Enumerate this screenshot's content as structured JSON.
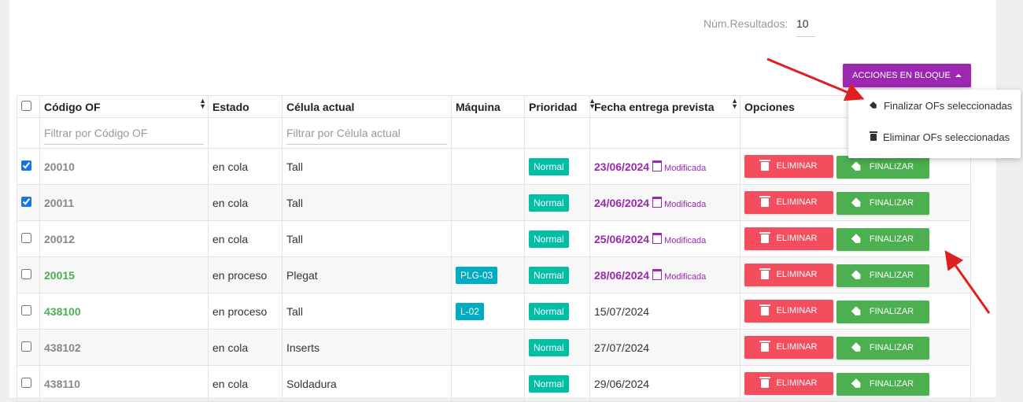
{
  "results": {
    "label": "Núm.Resultados:",
    "value": "10"
  },
  "bulk": {
    "label": "ACCIONES EN BLOQUE",
    "items": [
      {
        "icon": "tag-icon",
        "label": "Finalizar OFs seleccionadas"
      },
      {
        "icon": "trash-icon",
        "label": "Eliminar OFs seleccionadas"
      }
    ]
  },
  "columns": [
    "Código OF",
    "Estado",
    "Célula actual",
    "Máquina",
    "Prioridad",
    "Fecha entrega prevista",
    "Opciones"
  ],
  "filters": {
    "codigo_placeholder": "Filtrar por Código OF",
    "celula_placeholder": "Filtrar por Célula actual"
  },
  "buttons": {
    "delete": "ELIMINAR",
    "finish": "FINALIZAR"
  },
  "modified_label": "Modificada",
  "rows": [
    {
      "checked": true,
      "code": "20010",
      "code_style": "grey",
      "state": "en cola",
      "cell": "Tall",
      "machine": "",
      "priority": "Normal",
      "date": "23/06/2024",
      "modified": true
    },
    {
      "checked": true,
      "code": "20011",
      "code_style": "grey",
      "state": "en cola",
      "cell": "Tall",
      "machine": "",
      "priority": "Normal",
      "date": "24/06/2024",
      "modified": true
    },
    {
      "checked": false,
      "code": "20012",
      "code_style": "grey",
      "state": "en cola",
      "cell": "Tall",
      "machine": "",
      "priority": "Normal",
      "date": "25/06/2024",
      "modified": true
    },
    {
      "checked": false,
      "code": "20015",
      "code_style": "green",
      "state": "en proceso",
      "cell": "Plegat",
      "machine": "PLG-03",
      "priority": "Normal",
      "date": "28/06/2024",
      "modified": true
    },
    {
      "checked": false,
      "code": "438100",
      "code_style": "green",
      "state": "en proceso",
      "cell": "Tall",
      "machine": "L-02",
      "priority": "Normal",
      "date": "15/07/2024",
      "modified": false
    },
    {
      "checked": false,
      "code": "438102",
      "code_style": "grey",
      "state": "en cola",
      "cell": "Inserts",
      "machine": "",
      "priority": "Normal",
      "date": "27/07/2024",
      "modified": false
    },
    {
      "checked": false,
      "code": "438110",
      "code_style": "grey",
      "state": "en cola",
      "cell": "Soldadura",
      "machine": "",
      "priority": "Normal",
      "date": "29/06/2024",
      "modified": false
    }
  ],
  "colors": {
    "purple": "#9c27b0",
    "red": "#f44d5d",
    "green": "#4caf50",
    "teal": "#00bfa5",
    "cyan": "#00acc1",
    "arrow": "#e02020"
  }
}
